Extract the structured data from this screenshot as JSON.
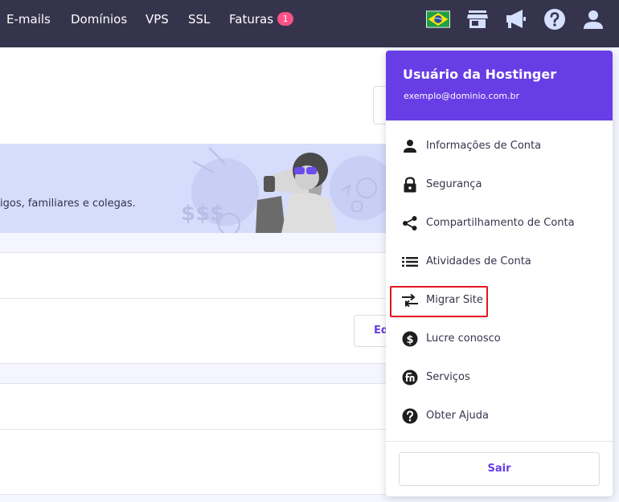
{
  "nav": {
    "items": [
      "E-mails",
      "Domínios",
      "VPS",
      "SSL",
      "Faturas"
    ],
    "invoices_badge": "1",
    "icons": [
      "brazil-flag-icon",
      "store-icon",
      "megaphone-icon",
      "help-icon",
      "user-icon"
    ]
  },
  "banner": {
    "text": "igos, familiares e colegas."
  },
  "background": {
    "partial_button_label": "Ed"
  },
  "account_menu": {
    "title": "Usuário da Hostinger",
    "email": "exemplo@dominio.com.br",
    "items": [
      {
        "label": "Informações de Conta",
        "icon": "user-icon"
      },
      {
        "label": "Segurança",
        "icon": "lock-icon"
      },
      {
        "label": "Compartilhamento de Conta",
        "icon": "share-icon"
      },
      {
        "label": "Atividades de Conta",
        "icon": "list-icon"
      },
      {
        "label": "Migrar Site",
        "icon": "migrate-arrows-icon",
        "highlighted": true
      },
      {
        "label": "Lucre conosco",
        "icon": "dollar-icon"
      },
      {
        "label": "Serviços",
        "icon": "services-icon"
      },
      {
        "label": "Obter Ajuda",
        "icon": "help-icon"
      }
    ],
    "logout_label": "Sair"
  },
  "colors": {
    "topbar": "#36344d",
    "primary": "#673de6",
    "badge": "#fc5185",
    "highlight_border": "#e0161e",
    "banner_bg": "#d6dcfb"
  }
}
